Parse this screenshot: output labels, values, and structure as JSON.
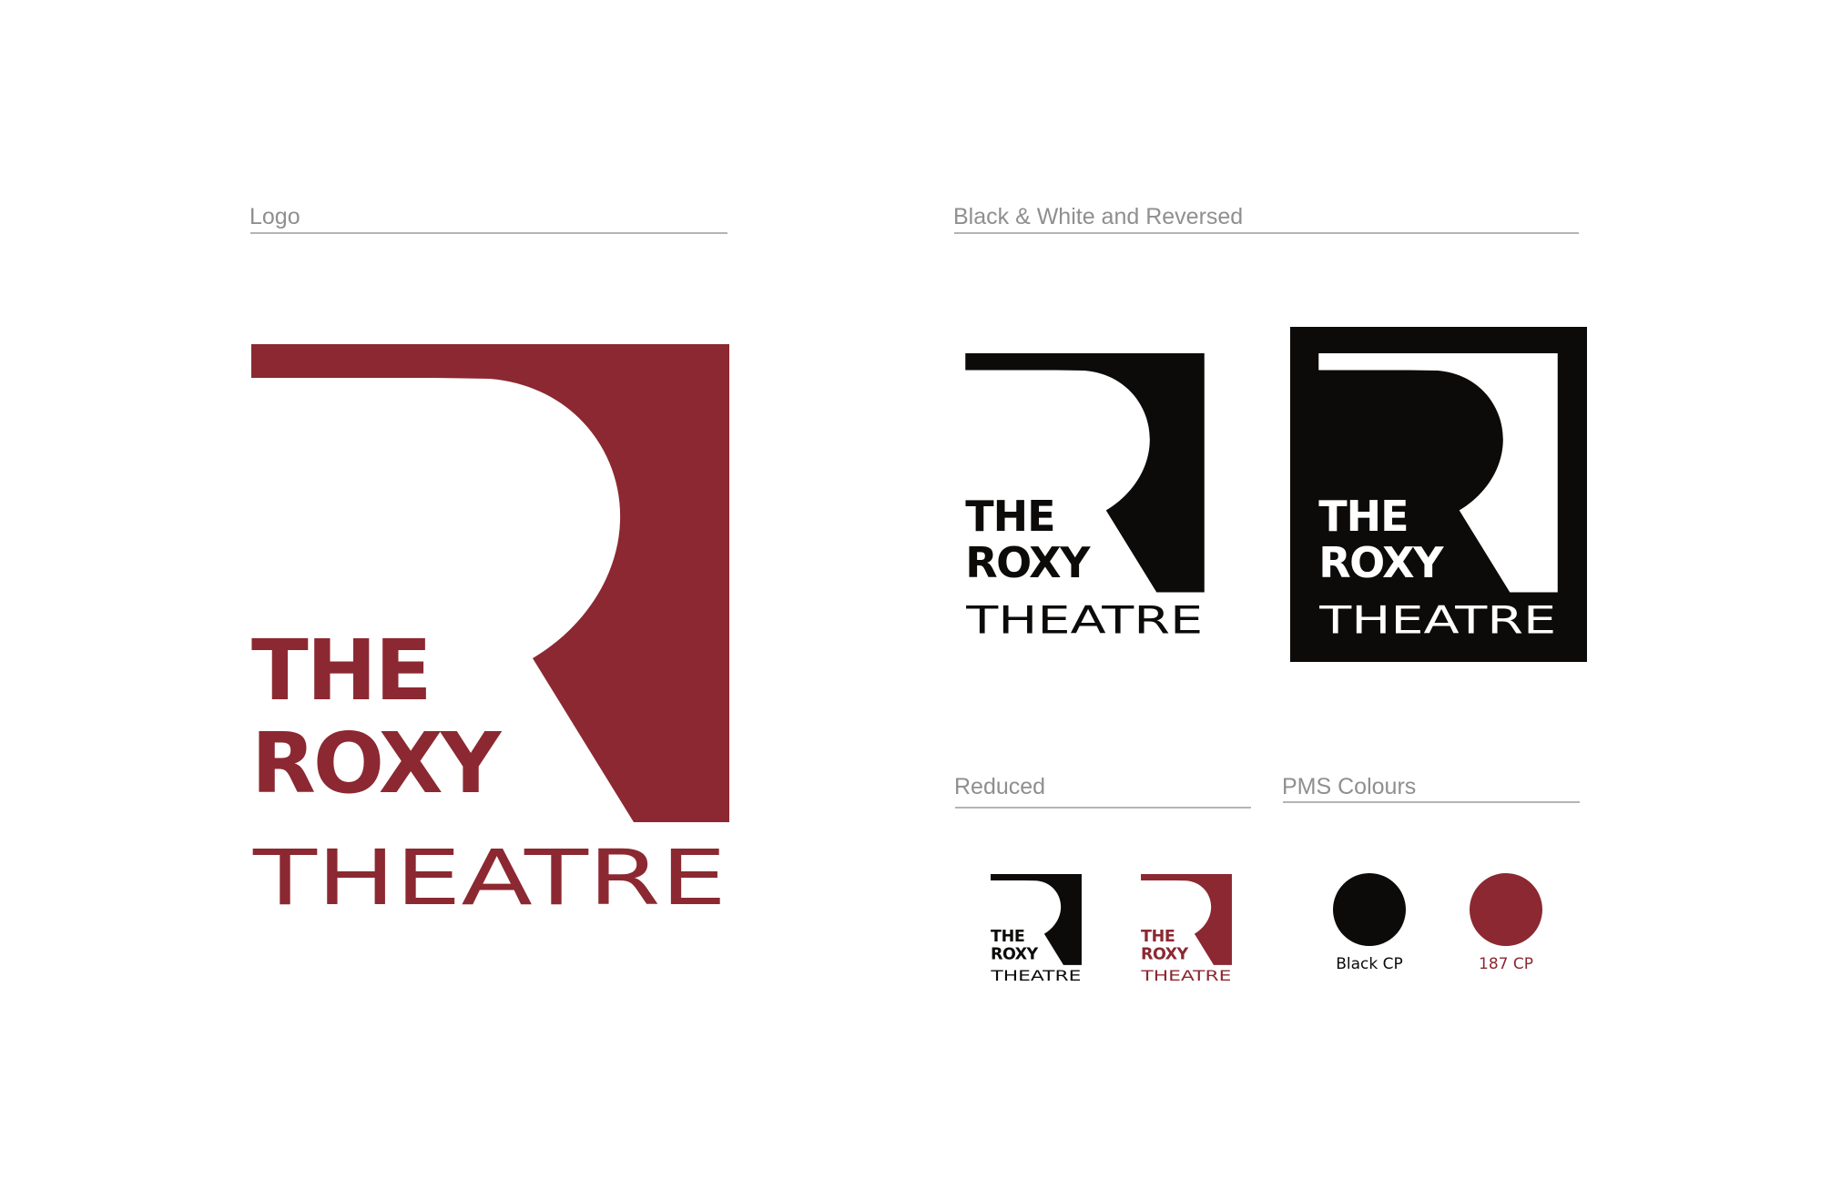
{
  "sections": {
    "logo": {
      "title": "Logo"
    },
    "bw_reversed": {
      "title": "Black & White and Reversed"
    },
    "reduced": {
      "title": "Reduced"
    },
    "pms": {
      "title": "PMS Colours"
    }
  },
  "logo": {
    "line1": "THE",
    "line2": "ROXY",
    "line3": "THEATRE"
  },
  "colors": {
    "brand_red": "#8c2831",
    "black": "#0c0b0a",
    "white": "#ffffff"
  },
  "swatches": [
    {
      "label": "Black CP",
      "color": "#0c0b0a"
    },
    {
      "label": "187 CP",
      "color": "#8c2831"
    }
  ]
}
